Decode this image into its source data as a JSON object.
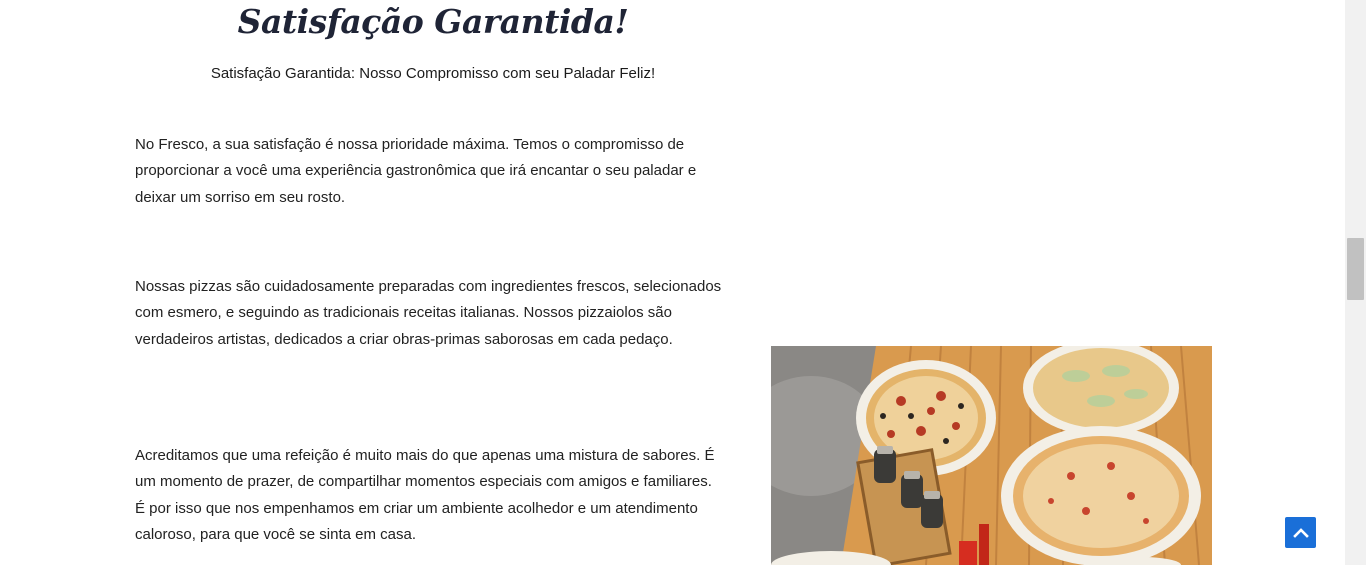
{
  "section": {
    "title": "Satisfação Garantida!",
    "subtitle": "Satisfação Garantida: Nosso Compromisso com seu Paladar Feliz!",
    "paragraphs": [
      "No Fresco, a sua satisfação é nossa prioridade máxima. Temos o compromisso de proporcionar a você uma experiência gastronômica que irá encantar o seu paladar e deixar um sorriso em seu rosto.",
      "Nossas pizzas são cuidadosamente preparadas com ingredientes frescos, selecionados com esmero, e seguindo as tradicionais receitas italianas. Nossos pizzaiolos são verdadeiros artistas, dedicados a criar obras-primas saborosas em cada pedaço.",
      "Acreditamos que uma refeição é muito mais do que apenas uma mistura de sabores. É um momento de prazer, de compartilhar momentos especiais com amigos e familiares. É por isso que nos empenhamos em criar um ambiente acolhedor e um atendimento caloroso, para que você se sinta em casa."
    ]
  },
  "image": {
    "subject": "pizzas on a wooden table"
  },
  "scroll_to_top": {
    "icon": "chevron-up-icon"
  },
  "colors": {
    "heading": "#1f2436",
    "accent": "#1a6fd8",
    "text": "#222222"
  }
}
